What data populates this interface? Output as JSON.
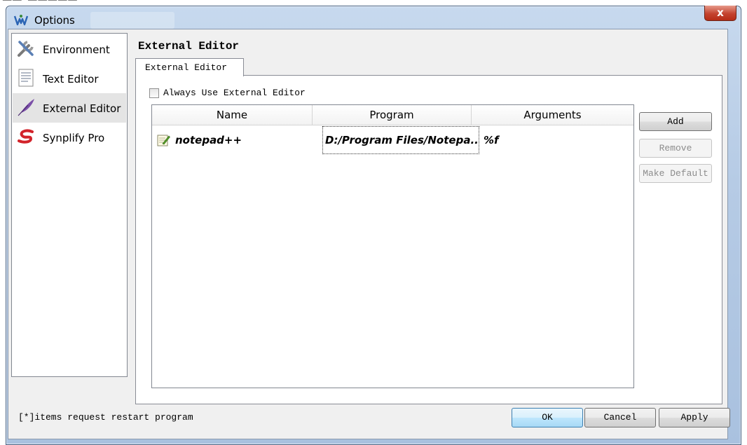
{
  "window": {
    "title": "Options",
    "close_glyph": "x",
    "icons": {
      "app": "app-logo-icon",
      "close": "close-icon"
    }
  },
  "nav": {
    "items": [
      {
        "label": "Environment",
        "icon": "tools-icon",
        "active": false
      },
      {
        "label": "Text Editor",
        "icon": "document-icon",
        "active": false
      },
      {
        "label": "External Editor",
        "icon": "quill-icon",
        "active": true
      },
      {
        "label": "Synplify Pro",
        "icon": "synplify-icon",
        "active": false
      }
    ]
  },
  "panel": {
    "heading": "External Editor",
    "tab_label": "External Editor",
    "checkbox_label": "Always Use External Editor",
    "checkbox_checked": false
  },
  "table": {
    "columns": [
      "Name",
      "Program",
      "Arguments"
    ],
    "rows": [
      {
        "name": "notepad++",
        "program": "D:/Program Files/Notepa...",
        "arguments": "%f",
        "icon": "notepad-icon"
      }
    ]
  },
  "buttons": {
    "add": "Add",
    "remove": "Remove",
    "make_default": "Make Default"
  },
  "footer": {
    "note": "[*]items request restart program",
    "ok": "OK",
    "cancel": "Cancel",
    "apply": "Apply"
  },
  "colors": {
    "titlebar": "#b6cbe5",
    "close_button": "#c4432f",
    "client_bg": "#f0f0f0",
    "nav_active": "#e4e4e4",
    "ok_button": "#bee6fd"
  }
}
